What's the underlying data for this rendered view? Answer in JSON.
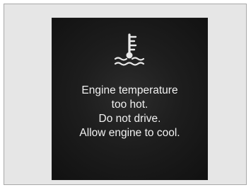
{
  "screen": {
    "icon": "engine-coolant-temperature-warning-icon",
    "message_lines": [
      "Engine temperature",
      "too hot.",
      "Do not drive.",
      "Allow engine to cool."
    ]
  },
  "colors": {
    "frame_background": "#e6e6e6",
    "display_background": "#1b1b1b",
    "text": "#f1f1f1",
    "icon": "#e9e9e9"
  }
}
